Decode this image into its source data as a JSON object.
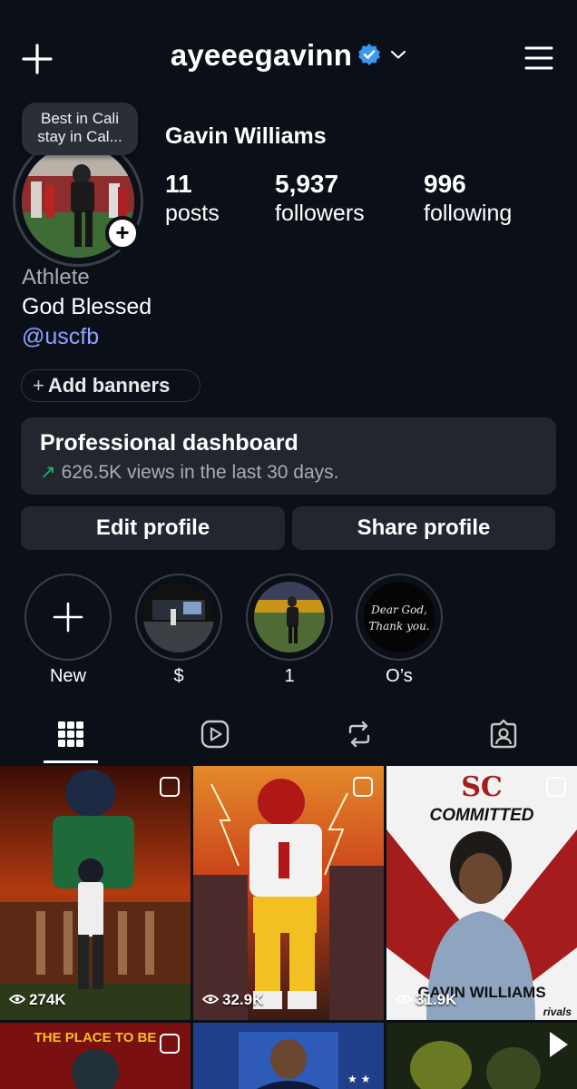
{
  "header": {
    "username": "ayeeegavinn",
    "icons": [
      "plus-icon",
      "verified-badge-icon",
      "chevron-down-icon",
      "menu-icon"
    ]
  },
  "note": {
    "line1": "Best in Cali",
    "line2": "stay in Cal..."
  },
  "profile": {
    "name": "Gavin Williams",
    "stats": [
      {
        "value": "11",
        "label": "posts"
      },
      {
        "value": "5,937",
        "label": "followers"
      },
      {
        "value": "996",
        "label": "following"
      }
    ],
    "category": "Athlete",
    "bio": "God Blessed",
    "link": "@uscfb"
  },
  "add_banners": {
    "plus": "+",
    "label": "Add banners"
  },
  "dashboard": {
    "title": "Professional dashboard",
    "arrow": "↗",
    "subtitle": "626.5K views in the last 30 days."
  },
  "actions": {
    "edit": "Edit profile",
    "share": "Share profile"
  },
  "highlights": [
    {
      "label": "New"
    },
    {
      "label": "$"
    },
    {
      "label": "1"
    },
    {
      "label": "O’s",
      "cover_text_1": "Dear God,",
      "cover_text_2": "Thank you."
    }
  ],
  "tabs": [
    "grid-icon",
    "reels-icon",
    "reposts-icon",
    "tagged-icon"
  ],
  "posts": [
    {
      "views": "274K"
    },
    {
      "views": "32.9K"
    },
    {
      "views": "31.9K",
      "headline": "COMMITTED",
      "school": "SC",
      "player": "GAVIN WILLIAMS",
      "brand": "rivals"
    },
    {
      "headline": "THE PLACE TO BE"
    },
    {},
    {}
  ],
  "colors": {
    "background": "#0b0f17",
    "card": "#22262e",
    "link": "#8fa3ff",
    "verified": "#3897f0",
    "trend": "#27b06a"
  }
}
